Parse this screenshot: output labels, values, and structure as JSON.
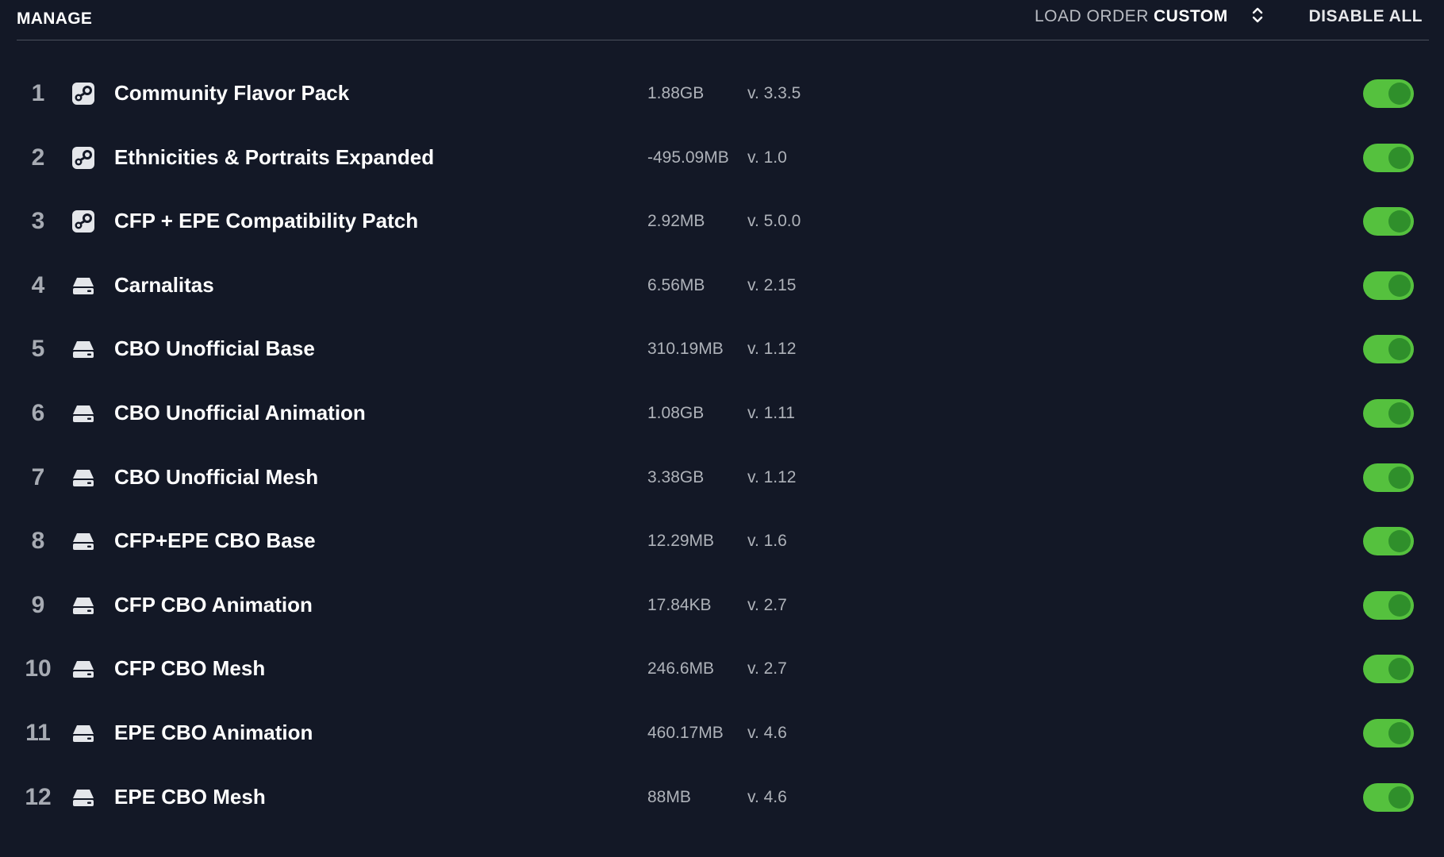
{
  "header": {
    "title": "MANAGE",
    "load_order_label": "LOAD ORDER",
    "load_order_value": "CUSTOM",
    "disable_all_label": "DISABLE ALL"
  },
  "colors": {
    "background": "#131826",
    "toggle_on": "#55c13e",
    "toggle_knob": "#2f8f2b"
  },
  "mods": [
    {
      "index": "1",
      "source": "steam-workshop-icon",
      "name": "Community Flavor Pack",
      "size": "1.88GB",
      "version": "v. 3.3.5",
      "enabled": true
    },
    {
      "index": "2",
      "source": "steam-workshop-icon",
      "name": "Ethnicities & Portraits Expanded",
      "size": "-495.09MB",
      "version": "v. 1.0",
      "enabled": true
    },
    {
      "index": "3",
      "source": "steam-workshop-icon",
      "name": "CFP + EPE Compatibility Patch",
      "size": "2.92MB",
      "version": "v. 5.0.0",
      "enabled": true
    },
    {
      "index": "4",
      "source": "local-drive-icon",
      "name": "Carnalitas",
      "size": "6.56MB",
      "version": "v. 2.15",
      "enabled": true
    },
    {
      "index": "5",
      "source": "local-drive-icon",
      "name": "CBO Unofficial Base",
      "size": "310.19MB",
      "version": "v. 1.12",
      "enabled": true
    },
    {
      "index": "6",
      "source": "local-drive-icon",
      "name": "CBO Unofficial Animation",
      "size": "1.08GB",
      "version": "v. 1.11",
      "enabled": true
    },
    {
      "index": "7",
      "source": "local-drive-icon",
      "name": "CBO Unofficial Mesh",
      "size": "3.38GB",
      "version": "v. 1.12",
      "enabled": true
    },
    {
      "index": "8",
      "source": "local-drive-icon",
      "name": "CFP+EPE CBO Base",
      "size": "12.29MB",
      "version": "v. 1.6",
      "enabled": true
    },
    {
      "index": "9",
      "source": "local-drive-icon",
      "name": "CFP CBO Animation",
      "size": "17.84KB",
      "version": "v. 2.7",
      "enabled": true
    },
    {
      "index": "10",
      "source": "local-drive-icon",
      "name": "CFP CBO Mesh",
      "size": "246.6MB",
      "version": "v. 2.7",
      "enabled": true
    },
    {
      "index": "11",
      "source": "local-drive-icon",
      "name": "EPE CBO Animation",
      "size": "460.17MB",
      "version": "v. 4.6",
      "enabled": true
    },
    {
      "index": "12",
      "source": "local-drive-icon",
      "name": "EPE CBO Mesh",
      "size": "88MB",
      "version": "v. 4.6",
      "enabled": true
    }
  ]
}
